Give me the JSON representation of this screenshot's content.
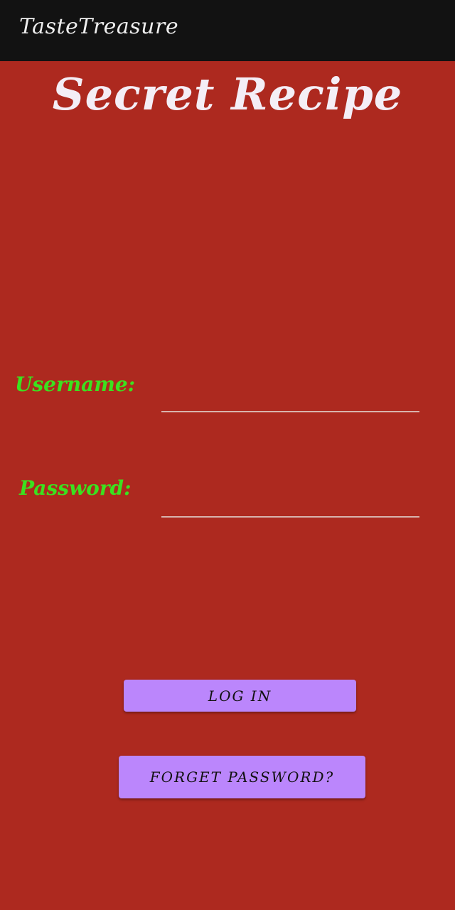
{
  "app_bar": {
    "title": "TasteTreasure"
  },
  "screen": {
    "title": "Secret Recipe",
    "username_label": "Username:",
    "password_label": "Password:",
    "username_value": "",
    "password_value": "",
    "login_label": "LOG IN",
    "forget_password_label": "FORGET PASSWORD?"
  },
  "colors": {
    "background": "#ad291f",
    "app_bar": "#121212",
    "label_green": "#3be11f",
    "button_purple": "#bb86fc"
  }
}
